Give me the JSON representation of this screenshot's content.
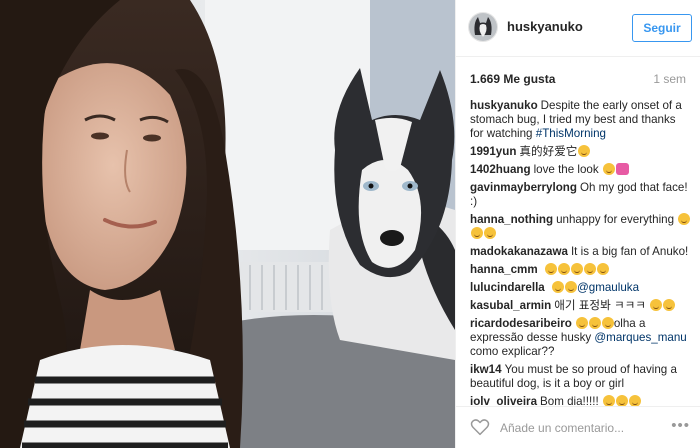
{
  "post": {
    "username": "huskyanuko",
    "follow_label": "Seguir",
    "likes": "1.669 Me gusta",
    "time": "1 sem",
    "caption_text": "Despite the early onset of a stomach bug, I tried my best and thanks for watching",
    "caption_hashtag": "#ThisMorning"
  },
  "comments": [
    {
      "user": "1991yun",
      "text": "真的好爱它",
      "emoji": "smile"
    },
    {
      "user": "1402huang",
      "text": "love the look",
      "emoji": "smile-heart"
    },
    {
      "user": "gavinmayberrylong",
      "text": "Oh my god that face! :)"
    },
    {
      "user": "hanna_nothing",
      "text": "unhappy for everything",
      "emoji": "laugh"
    },
    {
      "user": "madokakanazawa",
      "text": "It is a big fan of Anuko!"
    },
    {
      "user": "hanna_cmm",
      "text": "",
      "emoji": "many"
    },
    {
      "user": "lulucindarella",
      "text": "",
      "emoji": "laugh2",
      "mention": "@gmauluka"
    },
    {
      "user": "kasubal_armin",
      "text": "애기 표정봐 ㅋㅋㅋ",
      "emoji": "smile2"
    },
    {
      "user": "ricardodesaribeiro",
      "text": "olha a expressão desse husky",
      "mention": "@marques_manu",
      "text2": "como explicar??",
      "emoji": "laugh3"
    },
    {
      "user": "ikw14",
      "text": "You must be so proud of having a beautiful dog, is it a boy or girl"
    },
    {
      "user": "iolv_oliveira",
      "text": "Bom dia!!!!!",
      "emoji": "laugh3"
    }
  ],
  "footer": {
    "placeholder": "Añade un comentario...",
    "more": "•••"
  },
  "icons": {
    "like": "heart-outline-icon",
    "options": "more-options-icon"
  },
  "colors": {
    "accent": "#3897f0",
    "hashtag": "#003569",
    "text": "#262626",
    "muted": "#999999"
  }
}
